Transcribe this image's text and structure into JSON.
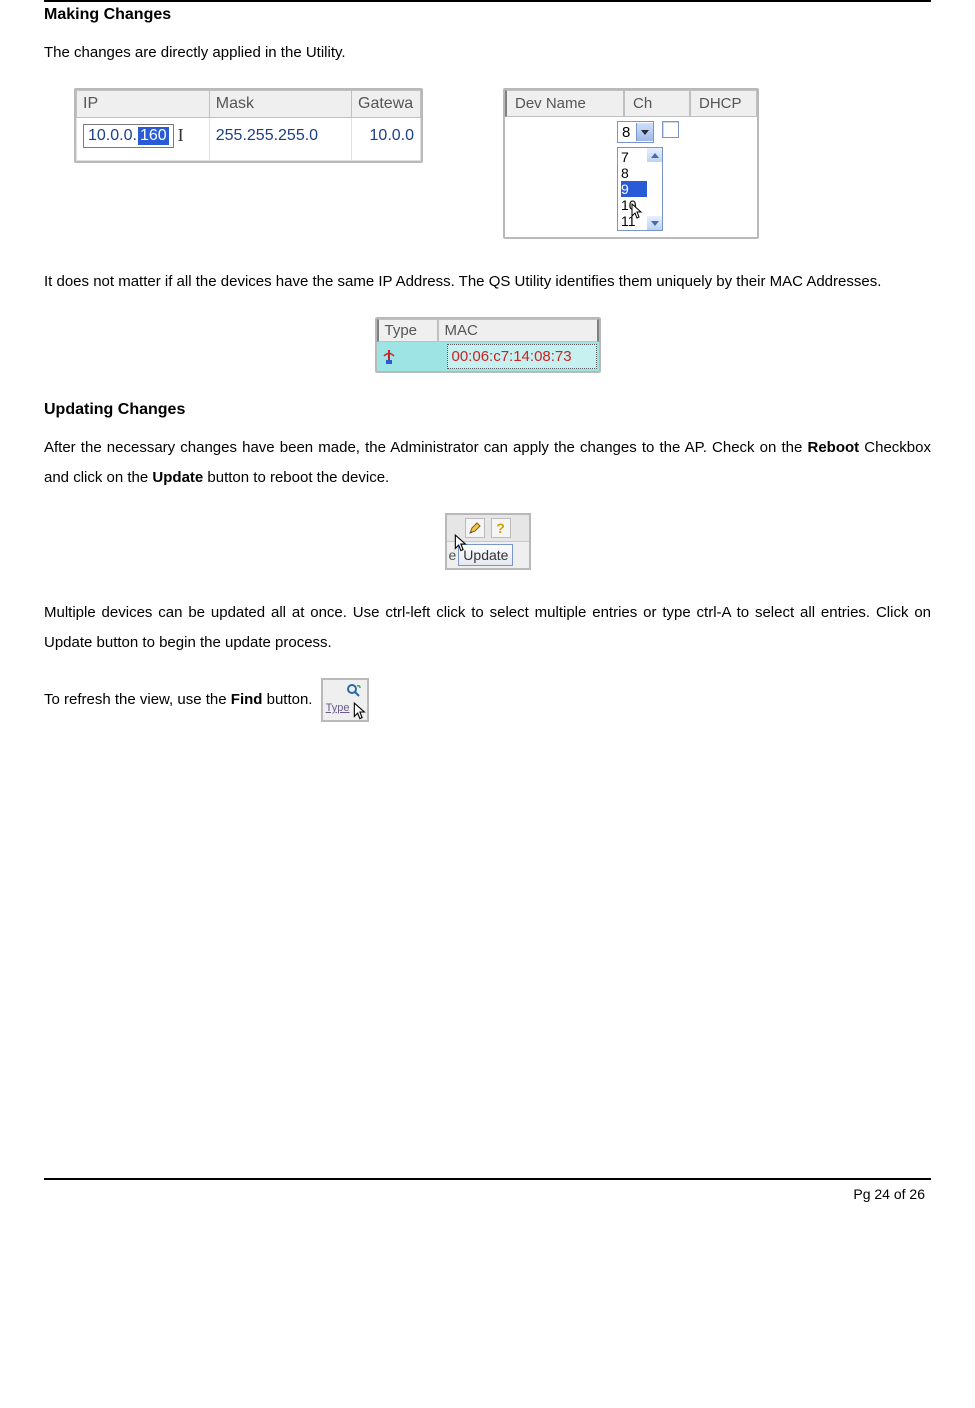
{
  "heading1": "Making Changes",
  "para1": "The changes are directly applied in the Utility.",
  "ip_table": {
    "col_ip": "IP",
    "col_mask": "Mask",
    "col_gw": "Gatewa",
    "ip_prefix": "10.0.0.",
    "ip_sel": "160",
    "mask": "255.255.255.0",
    "gw": "10.0.0"
  },
  "dev_table": {
    "col_dev": "Dev Name",
    "col_ch": "Ch",
    "col_dhcp": "DHCP",
    "combo_value": "8",
    "list": {
      "i0": "7",
      "i1": "8",
      "i2": "9",
      "i3": "10",
      "i4": "11"
    }
  },
  "para2": "It does not matter if all the devices have the same IP Address. The QS Utility identifies them uniquely by their MAC Addresses.",
  "mac_table": {
    "col_type": "Type",
    "col_mac": "MAC",
    "mac_value": "00:06:c7:14:08:73"
  },
  "heading2": "Updating Changes",
  "para3a": "After the necessary changes have been made, the Administrator can apply the changes to the AP. Check on the ",
  "para3b": "Reboot",
  "para3c": " Checkbox and click on the ",
  "para3d": "Update",
  "para3e": " button to reboot the device.",
  "update_panel": {
    "frag": "e",
    "btn": "Update"
  },
  "para4": "Multiple devices can be updated all at once. Use ctrl-left click to select multiple entries or type ctrl-A to select all entries. Click on Update button to begin the update process.",
  "para5a": "To refresh the view, use the ",
  "para5b": "Find",
  "para5c": " button. ",
  "find_label": "Type",
  "page_number": "Pg 24 of 26"
}
